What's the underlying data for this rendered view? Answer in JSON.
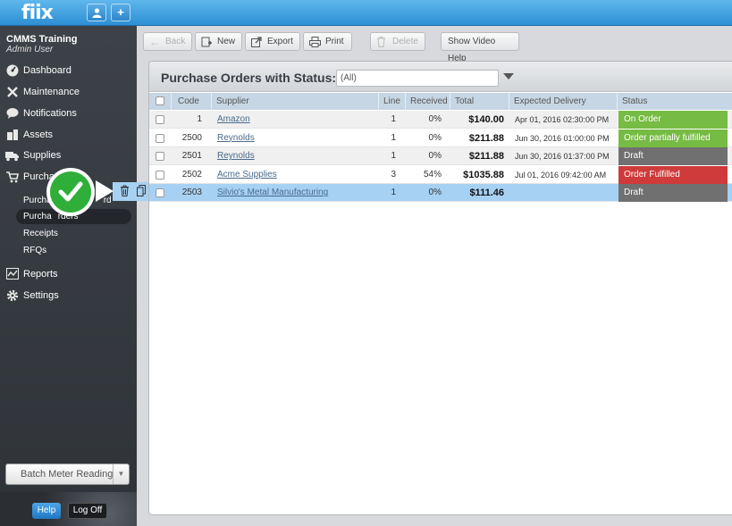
{
  "app": {
    "logo": "fiix"
  },
  "topbar": {
    "user_icon": "user-icon",
    "plus_label": "+"
  },
  "sidebar": {
    "org_name": "CMMS Training",
    "org_user": "Admin User",
    "items": [
      {
        "label": "Dashboard",
        "icon": "dashboard-icon"
      },
      {
        "label": "Maintenance",
        "icon": "wrench-icon"
      },
      {
        "label": "Notifications",
        "icon": "chat-bubble-icon"
      },
      {
        "label": "Assets",
        "icon": "boxes-icon"
      },
      {
        "label": "Supplies",
        "icon": "truck-icon"
      },
      {
        "label": "Purchasing",
        "icon": "cart-icon"
      },
      {
        "label": "Reports",
        "icon": "chart-icon"
      },
      {
        "label": "Settings",
        "icon": "gear-icon"
      }
    ],
    "purchasing_visible_label": "Purcha",
    "sub_items": [
      {
        "label": "Purchasing Board",
        "visible_prefix": "Purcha",
        "visible_suffix": "rd"
      },
      {
        "label": "Purchase Orders",
        "visible_prefix": "Purcha",
        "visible_suffix": "rders"
      },
      {
        "label": "Receipts"
      },
      {
        "label": "RFQs"
      }
    ],
    "batch_button": "Batch Meter Reading",
    "help_button": "Help",
    "logoff_button": "Log Off"
  },
  "toolbar": {
    "back": "Back",
    "new": "New",
    "export": "Export",
    "print": "Print",
    "delete": "Delete",
    "video_help": "Show Video Help"
  },
  "panel": {
    "title": "Purchase Orders with Status:",
    "status_filter": "(All)"
  },
  "table": {
    "columns": [
      "Code",
      "Supplier",
      "Line",
      "Received",
      "Total",
      "Expected Delivery",
      "Status"
    ],
    "rows": [
      {
        "code": "1",
        "supplier": "Amazon",
        "line": "1",
        "received": "0%",
        "total": "$140.00",
        "expected": "Apr 01, 2016 02:30:00 PM",
        "status": "On Order",
        "status_color": "#76bb43"
      },
      {
        "code": "2500",
        "supplier": "Reynolds",
        "line": "1",
        "received": "0%",
        "total": "$211.88",
        "expected": "Jun 30, 2016 01:00:00 PM",
        "status": "Order partially fulfilled",
        "status_color": "#76bb43"
      },
      {
        "code": "2501",
        "supplier": "Reynolds",
        "line": "1",
        "received": "0%",
        "total": "$211.88",
        "expected": "Jun 30, 2016 01:37:00 PM",
        "status": "Draft",
        "status_color": "#707070"
      },
      {
        "code": "2502",
        "supplier": "Acme Supplies",
        "line": "3",
        "received": "54%",
        "total": "$1035.88",
        "expected": "Jul 01, 2016 09:42:00 AM",
        "status": "Order Fulfilled",
        "status_color": "#cf3a3a"
      },
      {
        "code": "2503",
        "supplier": "Silvio's Metal Manufacturing",
        "line": "1",
        "received": "0%",
        "total": "$111.46",
        "expected": "",
        "status": "Draft",
        "status_color": "#707070"
      }
    ]
  },
  "overlay": {
    "check_icon": "check-circle-icon",
    "trash_icon": "trash-icon",
    "copy_icon": "copy-icon"
  }
}
